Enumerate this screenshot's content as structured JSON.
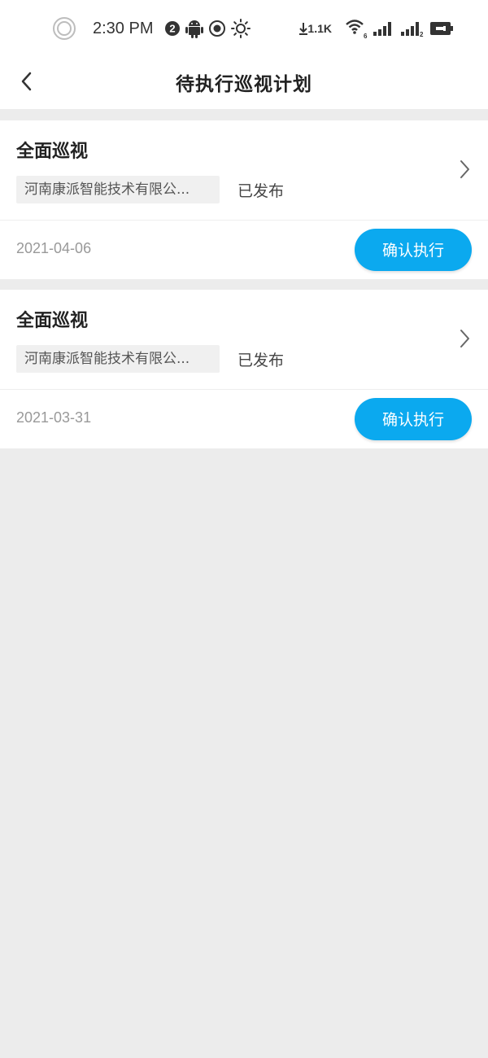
{
  "status_bar": {
    "time": "2:30 PM",
    "notification_count": "2",
    "network_speed": "1.1K",
    "wifi_label": "6",
    "signal2_label": "2"
  },
  "nav": {
    "title": "待执行巡视计划",
    "back_icon": "chevron-left-icon"
  },
  "plans": [
    {
      "title": "全面巡视",
      "company": "河南康派智能技术有限公...",
      "status": "已发布",
      "date": "2021-04-06",
      "action_label": "确认执行"
    },
    {
      "title": "全面巡视",
      "company": "河南康派智能技术有限公...",
      "status": "已发布",
      "date": "2021-03-31",
      "action_label": "确认执行"
    }
  ],
  "colors": {
    "accent": "#0ba9ef",
    "background": "#ececec",
    "card": "#ffffff"
  }
}
